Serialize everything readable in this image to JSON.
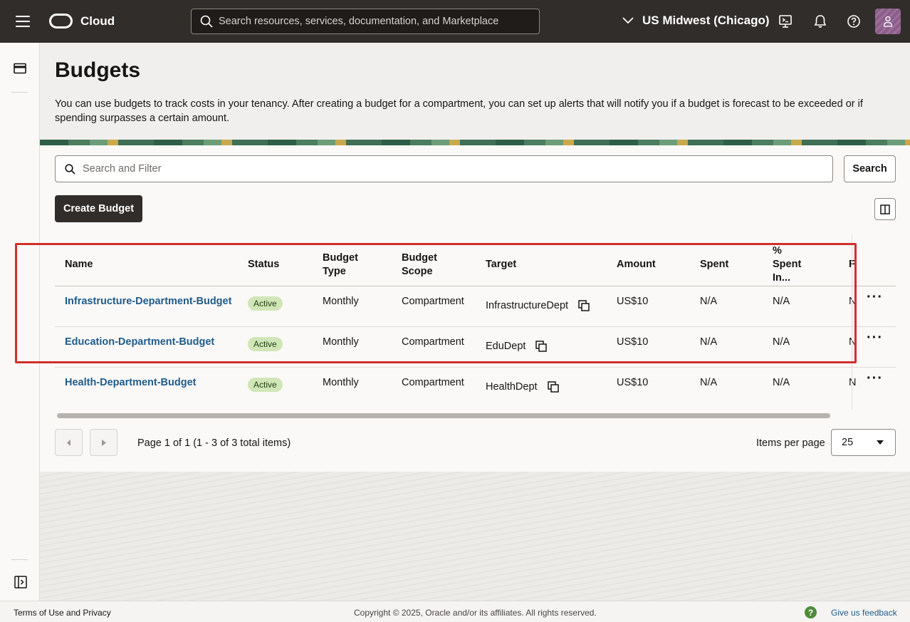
{
  "header": {
    "brand": "Cloud",
    "search_placeholder": "Search resources, services, documentation, and Marketplace",
    "region": "US Midwest (Chicago)"
  },
  "page": {
    "title": "Budgets",
    "description": "You can use budgets to track costs in your tenancy. After creating a budget for a compartment, you can set up alerts that will notify you if a budget is forecast to be exceeded or if spending surpasses a certain amount."
  },
  "toolbar": {
    "filter_placeholder": "Search and Filter",
    "search_label": "Search",
    "create_label": "Create Budget"
  },
  "table": {
    "columns": {
      "name": "Name",
      "status": "Status",
      "budget_type": "Budget Type",
      "budget_scope": "Budget Scope",
      "target": "Target",
      "amount": "Amount",
      "spent": "Spent",
      "pct_spent": "% Spent In...",
      "truncated": "F"
    },
    "rows": [
      {
        "name": "Infrastructure-Department-Budget",
        "status": "Active",
        "type": "Monthly",
        "scope": "Compartment",
        "target": "InfrastructureDept",
        "amount": "US$10",
        "spent": "N/A",
        "pct": "N/A",
        "truncated": "N"
      },
      {
        "name": "Education-Department-Budget",
        "status": "Active",
        "type": "Monthly",
        "scope": "Compartment",
        "target": "EduDept",
        "amount": "US$10",
        "spent": "N/A",
        "pct": "N/A",
        "truncated": "N"
      },
      {
        "name": "Health-Department-Budget",
        "status": "Active",
        "type": "Monthly",
        "scope": "Compartment",
        "target": "HealthDept",
        "amount": "US$10",
        "spent": "N/A",
        "pct": "N/A",
        "truncated": "N"
      }
    ],
    "row_menu": "···"
  },
  "pagination": {
    "summary": "Page 1 of 1 (1 - 3 of 3 total items)",
    "items_per_page_label": "Items per page",
    "items_per_page_value": "25"
  },
  "footer": {
    "terms": "Terms of Use and Privacy",
    "copyright": "Copyright © 2025, Oracle and/or its affiliates. All rights reserved.",
    "feedback": "Give us feedback",
    "feedback_icon": "?"
  },
  "colors": {
    "topbar": "#312d2a",
    "link": "#1f5c8b",
    "badge_bg": "#d1e6b7",
    "highlight": "#d0302a"
  }
}
